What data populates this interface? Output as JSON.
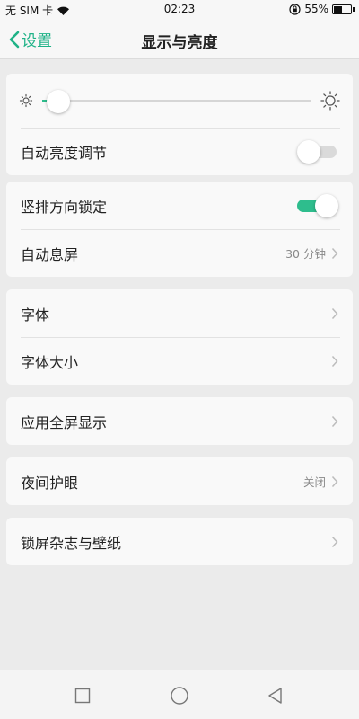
{
  "status_bar": {
    "carrier": "无 SIM 卡",
    "time": "02:23",
    "battery_percent": "55%",
    "battery_level": 0.55
  },
  "header": {
    "back_label": "设置",
    "title": "显示与亮度"
  },
  "brightness": {
    "level": 0.06,
    "auto_label": "自动亮度调节",
    "auto_on": false
  },
  "group2": {
    "orientation_label": "竖排方向锁定",
    "orientation_on": true,
    "sleep_label": "自动息屏",
    "sleep_value": "30 分钟"
  },
  "group3": {
    "font_label": "字体",
    "font_size_label": "字体大小"
  },
  "group4": {
    "fullscreen_label": "应用全屏显示"
  },
  "group5": {
    "night_label": "夜间护眼",
    "night_value": "关闭"
  },
  "group6": {
    "lockscreen_label": "锁屏杂志与壁纸"
  },
  "colors": {
    "accent": "#2ebd8d",
    "back_accent": "#1fb287",
    "background": "#ebebeb",
    "card": "#f9f9f9"
  }
}
